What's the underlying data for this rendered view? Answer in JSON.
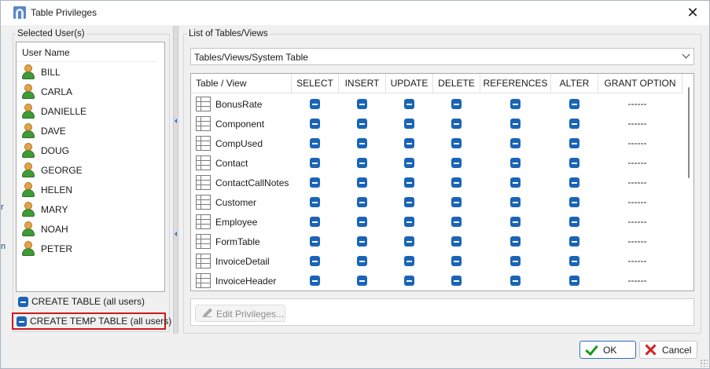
{
  "window": {
    "title": "Table Privileges"
  },
  "left_panel": {
    "group_label": "Selected User(s)",
    "column_header": "User Name",
    "users": [
      "BILL",
      "CARLA",
      "DANIELLE",
      "DAVE",
      "DOUG",
      "GEORGE",
      "HELEN",
      "MARY",
      "NOAH",
      "PETER"
    ],
    "create_table_label": "CREATE TABLE (all users)",
    "create_temp_table_label": "CREATE TEMP TABLE (all users)"
  },
  "right_panel": {
    "group_label": "List of Tables/Views",
    "filter_value": "Tables/Views/System Table",
    "columns": [
      "Table / View",
      "SELECT",
      "INSERT",
      "UPDATE",
      "DELETE",
      "REFERENCES",
      "ALTER",
      "GRANT OPTION"
    ],
    "rows": [
      {
        "name": "BonusRate",
        "grant": "------"
      },
      {
        "name": "Component",
        "grant": "------"
      },
      {
        "name": "CompUsed",
        "grant": "------"
      },
      {
        "name": "Contact",
        "grant": "------"
      },
      {
        "name": "ContactCallNotes",
        "grant": "------"
      },
      {
        "name": "Customer",
        "grant": "------"
      },
      {
        "name": "Employee",
        "grant": "------"
      },
      {
        "name": "FormTable",
        "grant": "------"
      },
      {
        "name": "InvoiceDetail",
        "grant": "------"
      },
      {
        "name": "InvoiceHeader",
        "grant": "------"
      }
    ],
    "edit_button": "Edit Privileges..."
  },
  "footer": {
    "ok_label": "OK",
    "cancel_label": "Cancel"
  },
  "background_window": {
    "partial_chars": [
      "r",
      "n"
    ]
  },
  "icons": {
    "app": "app-icon",
    "user": "person-icon",
    "table": "table-grid-icon",
    "ok": "checkmark-icon",
    "cancel": "red-x-icon",
    "edit": "pencil-icon"
  },
  "colors": {
    "checkbox": "#1a64b7",
    "highlight_border": "#d11a1a",
    "ok_border": "#2d6fc2"
  }
}
